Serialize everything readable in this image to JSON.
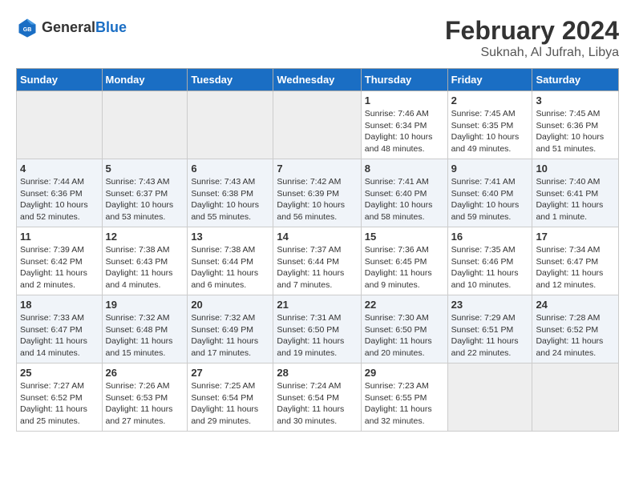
{
  "header": {
    "logo_general": "General",
    "logo_blue": "Blue",
    "month_year": "February 2024",
    "location": "Suknah, Al Jufrah, Libya"
  },
  "days_of_week": [
    "Sunday",
    "Monday",
    "Tuesday",
    "Wednesday",
    "Thursday",
    "Friday",
    "Saturday"
  ],
  "weeks": [
    [
      {
        "day": "",
        "info": ""
      },
      {
        "day": "",
        "info": ""
      },
      {
        "day": "",
        "info": ""
      },
      {
        "day": "",
        "info": ""
      },
      {
        "day": "1",
        "info": "Sunrise: 7:46 AM\nSunset: 6:34 PM\nDaylight: 10 hours\nand 48 minutes."
      },
      {
        "day": "2",
        "info": "Sunrise: 7:45 AM\nSunset: 6:35 PM\nDaylight: 10 hours\nand 49 minutes."
      },
      {
        "day": "3",
        "info": "Sunrise: 7:45 AM\nSunset: 6:36 PM\nDaylight: 10 hours\nand 51 minutes."
      }
    ],
    [
      {
        "day": "4",
        "info": "Sunrise: 7:44 AM\nSunset: 6:36 PM\nDaylight: 10 hours\nand 52 minutes."
      },
      {
        "day": "5",
        "info": "Sunrise: 7:43 AM\nSunset: 6:37 PM\nDaylight: 10 hours\nand 53 minutes."
      },
      {
        "day": "6",
        "info": "Sunrise: 7:43 AM\nSunset: 6:38 PM\nDaylight: 10 hours\nand 55 minutes."
      },
      {
        "day": "7",
        "info": "Sunrise: 7:42 AM\nSunset: 6:39 PM\nDaylight: 10 hours\nand 56 minutes."
      },
      {
        "day": "8",
        "info": "Sunrise: 7:41 AM\nSunset: 6:40 PM\nDaylight: 10 hours\nand 58 minutes."
      },
      {
        "day": "9",
        "info": "Sunrise: 7:41 AM\nSunset: 6:40 PM\nDaylight: 10 hours\nand 59 minutes."
      },
      {
        "day": "10",
        "info": "Sunrise: 7:40 AM\nSunset: 6:41 PM\nDaylight: 11 hours\nand 1 minute."
      }
    ],
    [
      {
        "day": "11",
        "info": "Sunrise: 7:39 AM\nSunset: 6:42 PM\nDaylight: 11 hours\nand 2 minutes."
      },
      {
        "day": "12",
        "info": "Sunrise: 7:38 AM\nSunset: 6:43 PM\nDaylight: 11 hours\nand 4 minutes."
      },
      {
        "day": "13",
        "info": "Sunrise: 7:38 AM\nSunset: 6:44 PM\nDaylight: 11 hours\nand 6 minutes."
      },
      {
        "day": "14",
        "info": "Sunrise: 7:37 AM\nSunset: 6:44 PM\nDaylight: 11 hours\nand 7 minutes."
      },
      {
        "day": "15",
        "info": "Sunrise: 7:36 AM\nSunset: 6:45 PM\nDaylight: 11 hours\nand 9 minutes."
      },
      {
        "day": "16",
        "info": "Sunrise: 7:35 AM\nSunset: 6:46 PM\nDaylight: 11 hours\nand 10 minutes."
      },
      {
        "day": "17",
        "info": "Sunrise: 7:34 AM\nSunset: 6:47 PM\nDaylight: 11 hours\nand 12 minutes."
      }
    ],
    [
      {
        "day": "18",
        "info": "Sunrise: 7:33 AM\nSunset: 6:47 PM\nDaylight: 11 hours\nand 14 minutes."
      },
      {
        "day": "19",
        "info": "Sunrise: 7:32 AM\nSunset: 6:48 PM\nDaylight: 11 hours\nand 15 minutes."
      },
      {
        "day": "20",
        "info": "Sunrise: 7:32 AM\nSunset: 6:49 PM\nDaylight: 11 hours\nand 17 minutes."
      },
      {
        "day": "21",
        "info": "Sunrise: 7:31 AM\nSunset: 6:50 PM\nDaylight: 11 hours\nand 19 minutes."
      },
      {
        "day": "22",
        "info": "Sunrise: 7:30 AM\nSunset: 6:50 PM\nDaylight: 11 hours\nand 20 minutes."
      },
      {
        "day": "23",
        "info": "Sunrise: 7:29 AM\nSunset: 6:51 PM\nDaylight: 11 hours\nand 22 minutes."
      },
      {
        "day": "24",
        "info": "Sunrise: 7:28 AM\nSunset: 6:52 PM\nDaylight: 11 hours\nand 24 minutes."
      }
    ],
    [
      {
        "day": "25",
        "info": "Sunrise: 7:27 AM\nSunset: 6:52 PM\nDaylight: 11 hours\nand 25 minutes."
      },
      {
        "day": "26",
        "info": "Sunrise: 7:26 AM\nSunset: 6:53 PM\nDaylight: 11 hours\nand 27 minutes."
      },
      {
        "day": "27",
        "info": "Sunrise: 7:25 AM\nSunset: 6:54 PM\nDaylight: 11 hours\nand 29 minutes."
      },
      {
        "day": "28",
        "info": "Sunrise: 7:24 AM\nSunset: 6:54 PM\nDaylight: 11 hours\nand 30 minutes."
      },
      {
        "day": "29",
        "info": "Sunrise: 7:23 AM\nSunset: 6:55 PM\nDaylight: 11 hours\nand 32 minutes."
      },
      {
        "day": "",
        "info": ""
      },
      {
        "day": "",
        "info": ""
      }
    ]
  ]
}
